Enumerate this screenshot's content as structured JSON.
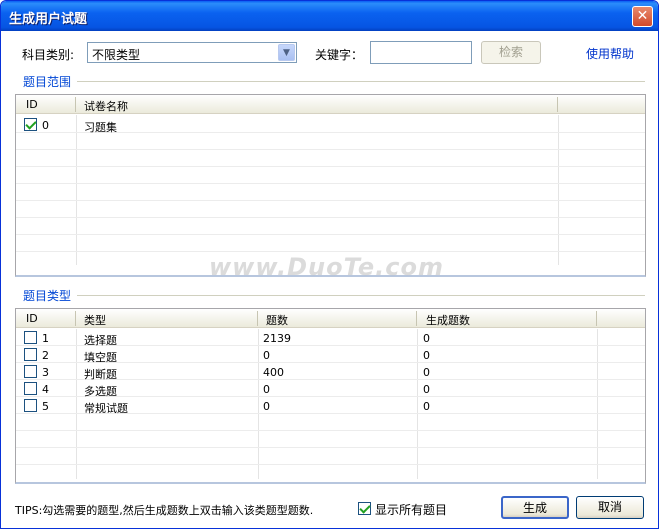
{
  "window": {
    "title": "生成用户试题",
    "close_glyph": "✕"
  },
  "filters": {
    "subject_label": "科目类别:",
    "subject_value": "不限类型",
    "keyword_label": "关键字：",
    "keyword_value": "",
    "search_label": "检索",
    "help_label": "使用帮助"
  },
  "scope_group": {
    "title": "题目范围",
    "columns": [
      "ID",
      "试卷名称"
    ],
    "rows": [
      {
        "checked": true,
        "id": "0",
        "name": "习题集"
      }
    ]
  },
  "type_group": {
    "title": "题目类型",
    "columns": [
      "ID",
      "类型",
      "题数",
      "生成题数"
    ],
    "rows": [
      {
        "checked": false,
        "id": "1",
        "type": "选择题",
        "count": "2139",
        "gen": "0"
      },
      {
        "checked": false,
        "id": "2",
        "type": "填空题",
        "count": "0",
        "gen": "0"
      },
      {
        "checked": false,
        "id": "3",
        "type": "判断题",
        "count": "400",
        "gen": "0"
      },
      {
        "checked": false,
        "id": "4",
        "type": "多选题",
        "count": "0",
        "gen": "0"
      },
      {
        "checked": false,
        "id": "5",
        "type": "常规试题",
        "count": "0",
        "gen": "0"
      }
    ]
  },
  "footer": {
    "tips": "TIPS:勾选需要的题型,然后生成题数上双击输入该类题型题数.",
    "show_all_label": "显示所有题目",
    "show_all_checked": true,
    "generate_label": "生成",
    "cancel_label": "取消"
  },
  "watermark": "www.DuoTe.com"
}
